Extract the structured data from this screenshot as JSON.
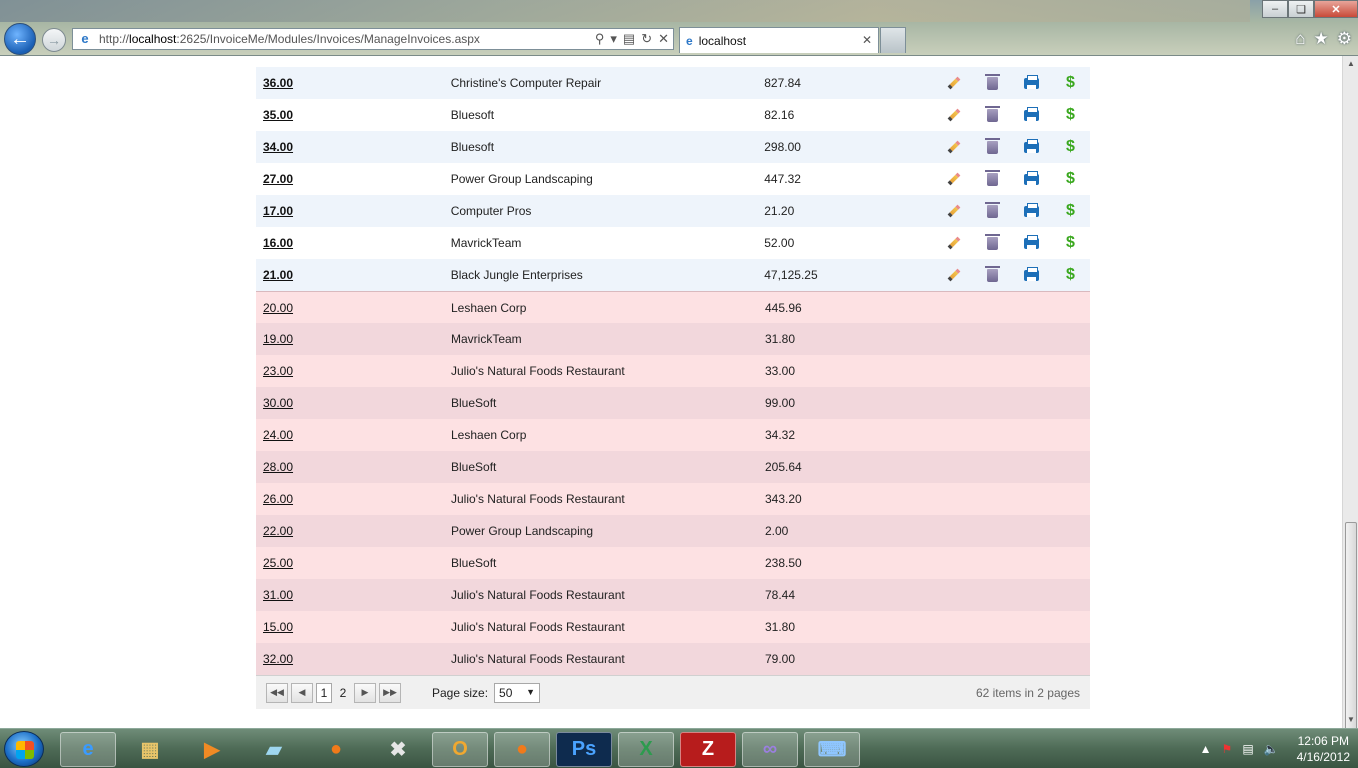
{
  "browser": {
    "url_prefix": "http://",
    "url_host": "localhost",
    "url_rest": ":2625/InvoiceMe/Modules/Invoices/ManageInvoices.aspx",
    "tab_title": "localhost"
  },
  "grid": {
    "active_rows": [
      {
        "number": "36.00",
        "customer": "Christine's Computer Repair",
        "amount": "827.84"
      },
      {
        "number": "35.00",
        "customer": "Bluesoft",
        "amount": "82.16"
      },
      {
        "number": "34.00",
        "customer": "Bluesoft",
        "amount": "298.00"
      },
      {
        "number": "27.00",
        "customer": "Power Group Landscaping",
        "amount": "447.32"
      },
      {
        "number": "17.00",
        "customer": "Computer Pros",
        "amount": "21.20"
      },
      {
        "number": "16.00",
        "customer": "MavrickTeam",
        "amount": "52.00"
      },
      {
        "number": "21.00",
        "customer": "Black Jungle Enterprises",
        "amount": "47,125.25"
      }
    ],
    "paid_rows": [
      {
        "number": "20.00",
        "customer": "Leshaen Corp",
        "amount": "445.96"
      },
      {
        "number": "19.00",
        "customer": "MavrickTeam",
        "amount": "31.80"
      },
      {
        "number": "23.00",
        "customer": "Julio's Natural Foods Restaurant",
        "amount": "33.00"
      },
      {
        "number": "30.00",
        "customer": "BlueSoft",
        "amount": "99.00"
      },
      {
        "number": "24.00",
        "customer": "Leshaen Corp",
        "amount": "34.32"
      },
      {
        "number": "28.00",
        "customer": "BlueSoft",
        "amount": "205.64"
      },
      {
        "number": "26.00",
        "customer": "Julio's Natural Foods Restaurant",
        "amount": "343.20"
      },
      {
        "number": "22.00",
        "customer": "Power Group Landscaping",
        "amount": "2.00"
      },
      {
        "number": "25.00",
        "customer": "BlueSoft",
        "amount": "238.50"
      },
      {
        "number": "31.00",
        "customer": "Julio's Natural Foods Restaurant",
        "amount": "78.44"
      },
      {
        "number": "15.00",
        "customer": "Julio's Natural Foods Restaurant",
        "amount": "31.80"
      },
      {
        "number": "32.00",
        "customer": "Julio's Natural Foods Restaurant",
        "amount": "79.00"
      }
    ],
    "action_icons": [
      "edit-icon",
      "delete-icon",
      "print-icon",
      "payment-icon"
    ],
    "colors": {
      "active_row_alt": "#eef4fb",
      "paid_row": "#fde1e3",
      "paid_row_alt": "#f2d7dc",
      "payment_green": "#3aa81f",
      "print_blue": "#1d6fb8"
    }
  },
  "pager": {
    "pages": [
      "1",
      "2"
    ],
    "current_page": "1",
    "page_size_label": "Page size:",
    "page_size_value": "50",
    "summary": "62 items in 2 pages"
  },
  "taskbar": {
    "time": "12:06 PM",
    "date": "4/16/2012",
    "apps": [
      "internet-explorer",
      "windows-explorer",
      "media-player",
      "notepad",
      "firefox",
      "tools",
      "outlook",
      "firefox",
      "photoshop",
      "excel",
      "filezilla",
      "visual-studio",
      "remote-desktop"
    ]
  }
}
